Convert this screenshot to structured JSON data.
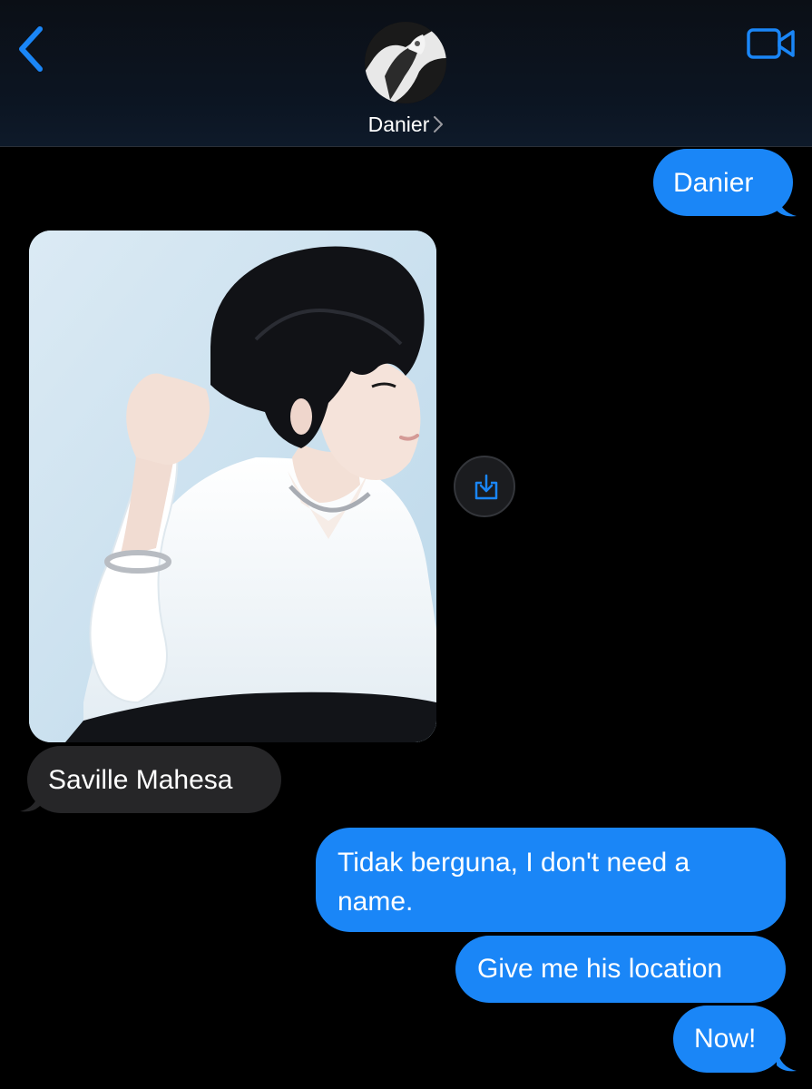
{
  "header": {
    "contact_name": "Danier",
    "back_icon": "chevron-left-icon",
    "video_icon": "video-camera-icon",
    "accent_color": "#1a86f7"
  },
  "messages": [
    {
      "side": "sent",
      "type": "text",
      "text": "Danier"
    },
    {
      "side": "received",
      "type": "photo",
      "save_icon": "save-download-icon"
    },
    {
      "side": "received",
      "type": "text",
      "text": "Saville Mahesa"
    },
    {
      "side": "sent",
      "type": "text",
      "text": "Tidak berguna, I don't need a name."
    },
    {
      "side": "sent",
      "type": "text",
      "text": "Give me his location"
    },
    {
      "side": "sent",
      "type": "text",
      "text": "Now!"
    }
  ],
  "colors": {
    "sent_bubble": "#1a86f7",
    "received_bubble": "#262628",
    "background": "#000000"
  }
}
